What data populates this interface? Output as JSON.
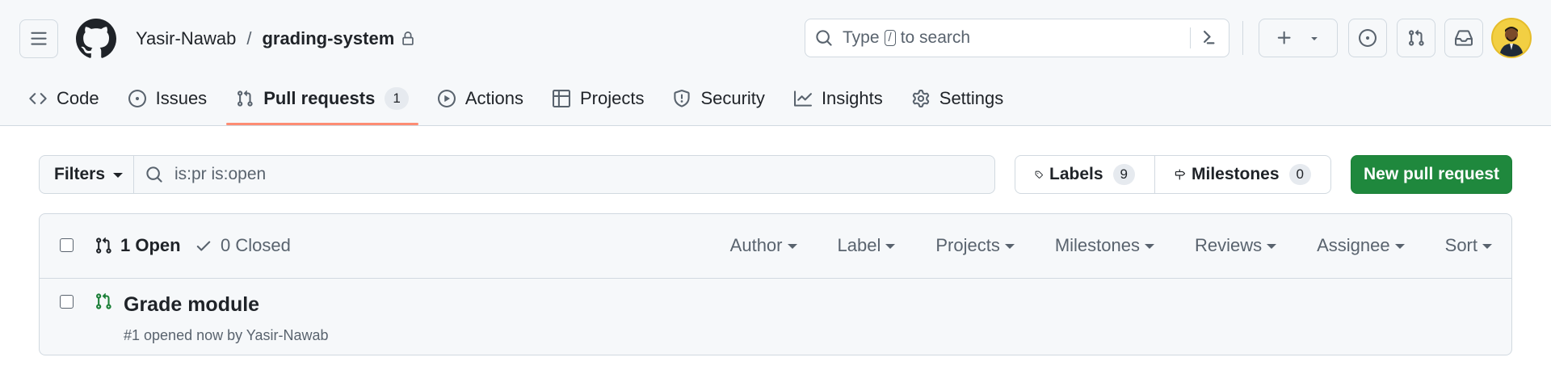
{
  "header": {
    "owner": "Yasir-Nawab",
    "separator": "/",
    "repo": "grading-system",
    "search": {
      "before": "Type",
      "key": "/",
      "after": "to search"
    }
  },
  "tabs": [
    {
      "label": "Code",
      "icon": "code-icon"
    },
    {
      "label": "Issues",
      "icon": "issue-opened-icon"
    },
    {
      "label": "Pull requests",
      "icon": "git-pull-request-icon",
      "count": "1",
      "selected": true
    },
    {
      "label": "Actions",
      "icon": "play-icon"
    },
    {
      "label": "Projects",
      "icon": "table-icon"
    },
    {
      "label": "Security",
      "icon": "shield-icon"
    },
    {
      "label": "Insights",
      "icon": "graph-icon"
    },
    {
      "label": "Settings",
      "icon": "gear-icon"
    }
  ],
  "filterbar": {
    "filters_label": "Filters",
    "query": "is:pr is:open",
    "labels_label": "Labels",
    "labels_count": "9",
    "milestones_label": "Milestones",
    "milestones_count": "0",
    "new_pr_label": "New pull request"
  },
  "list": {
    "open_label": "1 Open",
    "closed_label": "0 Closed",
    "filters": [
      "Author",
      "Label",
      "Projects",
      "Milestones",
      "Reviews",
      "Assignee",
      "Sort"
    ],
    "items": [
      {
        "title": "Grade module",
        "meta": "#1 opened now by Yasir-Nawab"
      }
    ]
  },
  "colors": {
    "accent_tab": "#fd8c73",
    "primary_button": "#1f883d",
    "open_pr": "#1a7f37"
  }
}
